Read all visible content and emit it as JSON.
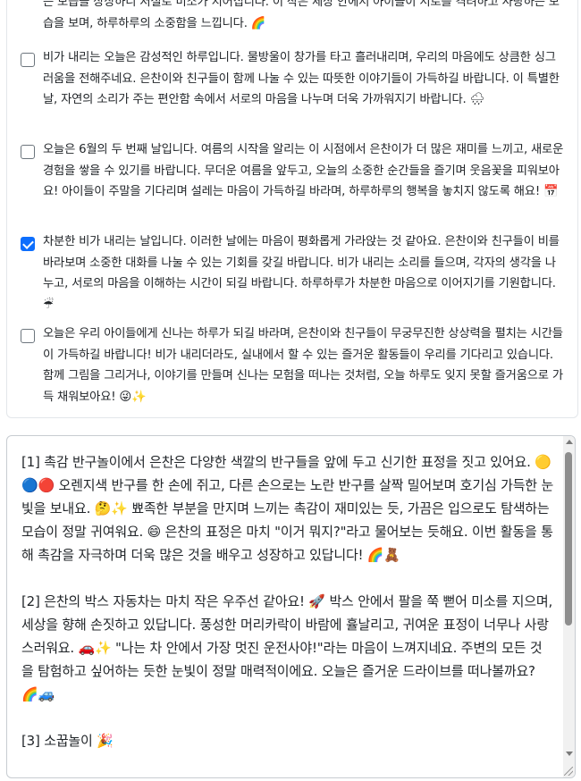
{
  "checklist": {
    "items": [
      {
        "checked": false,
        "partial": true,
        "text": "는 모습을 상상하니 저절로 미소가 지어집니다. 이 작은 세상 안에서 아이들이 서로를 격려하고 사랑하는 모습을 보며, 하루하루의 소중함을 느낍니다. 🌈"
      },
      {
        "checked": false,
        "text": "비가 내리는 오늘은 감성적인 하루입니다. 물방울이 창가를 타고 흘러내리며, 우리의 마음에도 상큼한 싱그러움을 전해주네요. 은찬이와 친구들이 함께 나눌 수 있는 따뜻한 이야기들이 가득하길 바랍니다. 이 특별한 날, 자연의 소리가 주는 편안함 속에서 서로의 마음을 나누며 더욱 가까워지기 바랍니다. 🌧"
      },
      {
        "checked": false,
        "text": "오늘은 6월의 두 번째 날입니다. 여름의 시작을 알리는 이 시점에서 은찬이가 더 많은 재미를 느끼고, 새로운 경험을 쌓을 수 있기를 바랍니다. 무더운 여름을 앞두고, 오늘의 소중한 순간들을 즐기며 웃음꽃을 피워보아요! 아이들이 주말을 기다리며 설레는 마음이 가득하길 바라며, 하루하루의 행복을 놓치지 않도록 해요! 📅"
      },
      {
        "checked": true,
        "text": "차분한 비가 내리는 날입니다. 이러한 날에는 마음이 평화롭게 가라앉는 것 같아요. 은찬이와 친구들이 비를 바라보며 소중한 대화를 나눌 수 있는 기회를 갖길 바랍니다. 비가 내리는 소리를 들으며, 각자의 생각을 나누고, 서로의 마음을 이해하는 시간이 되길 바랍니다. 하루하루가 차분한 마음으로 이어지기를 기원합니다. ☔"
      },
      {
        "checked": false,
        "text": "오늘은 우리 아이들에게 신나는 하루가 되길 바라며, 은찬이와 친구들이 무궁무진한 상상력을 펼치는 시간들이 가득하길 바랍니다! 비가 내리더라도, 실내에서 할 수 있는 즐거운 활동들이 우리를 기다리고 있습니다. 함께 그림을 그리거나, 이야기를 만들며 신나는 모험을 떠나는 것처럼, 오늘 하루도 잊지 못할 즐거움으로 가득 채워보아요! 😜✨"
      }
    ]
  },
  "editor": {
    "text": "[1] 촉감 반구놀이에서 은찬은 다양한 색깔의 반구들을 앞에 두고 신기한 표정을 짓고 있어요. 🟡🔵🔴 오렌지색 반구를 한 손에 쥐고, 다른 손으로는 노란 반구를 살짝 밀어보며 호기심 가득한 눈빛을 보내요. 🤔✨ 뾰족한 부분을 만지며 느끼는 촉감이 재미있는 듯, 가끔은 입으로도 탐색하는 모습이 정말 귀여워요. 😄 은찬의 표정은 마치 \"이거 뭐지?\"라고 물어보는 듯해요. 이번 활동을 통해 촉감을 자극하며 더욱 많은 것을 배우고 성장하고 있답니다! 🌈🧸\n\n[2] 은찬의 박스 자동차는 마치 작은 우주선 같아요! 🚀 박스 안에서 팔을 쭉 뻗어 미소를 지으며, 세상을 향해 손짓하고 있답니다. 풍성한 머리카락이 바람에 휼날리고, 귀여운 표정이 너무나 사랑스러워요. 🚗✨ \"나는 차 안에서 가장 멋진 운전사야!\"라는 마음이 느껴지네요. 주변의 모든 것을 탐험하고 싶어하는 듯한 눈빛이 정말 매력적이에요. 오늘은 즐거운 드라이브를 떠나볼까요? 🌈🚙\n\n[3] 소꿉놀이 🎉"
  }
}
